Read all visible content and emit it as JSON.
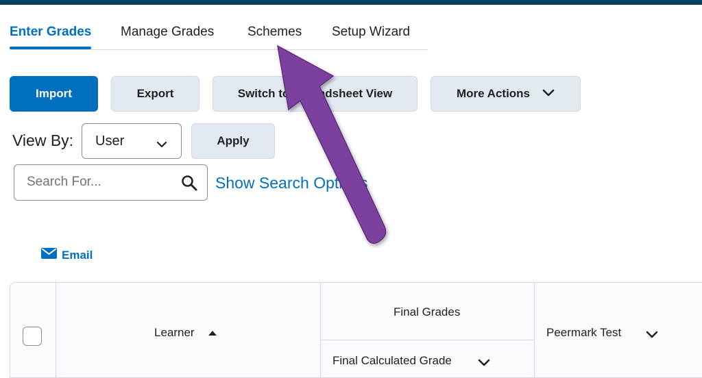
{
  "tabs": [
    {
      "label": "Enter Grades",
      "active": true
    },
    {
      "label": "Manage Grades",
      "active": false
    },
    {
      "label": "Schemes",
      "active": false
    },
    {
      "label": "Setup Wizard",
      "active": false
    }
  ],
  "toolbar": {
    "import_label": "Import",
    "export_label": "Export",
    "switch_view_label": "Switch to Spreadsheet View",
    "more_actions_label": "More Actions"
  },
  "view_by": {
    "label": "View By:",
    "selected": "User",
    "apply_label": "Apply"
  },
  "search": {
    "placeholder": "Search For...",
    "show_options_label": "Show Search Options"
  },
  "email_label": "Email",
  "grid": {
    "learner_header": "Learner",
    "final_grades_header": "Final Grades",
    "final_calculated_header": "Final Calculated Grade",
    "peermark_header": "Peermark Test"
  },
  "colors": {
    "accent": "#006fbf",
    "topbar": "#0b3e62",
    "secondary_button": "#e3e9f1",
    "annotation_arrow": "#7b3f9e"
  },
  "icons": {
    "dropdown": "chevron-down-icon",
    "search": "search-icon",
    "email": "envelope-icon",
    "sort": "sort-ascending-icon"
  }
}
